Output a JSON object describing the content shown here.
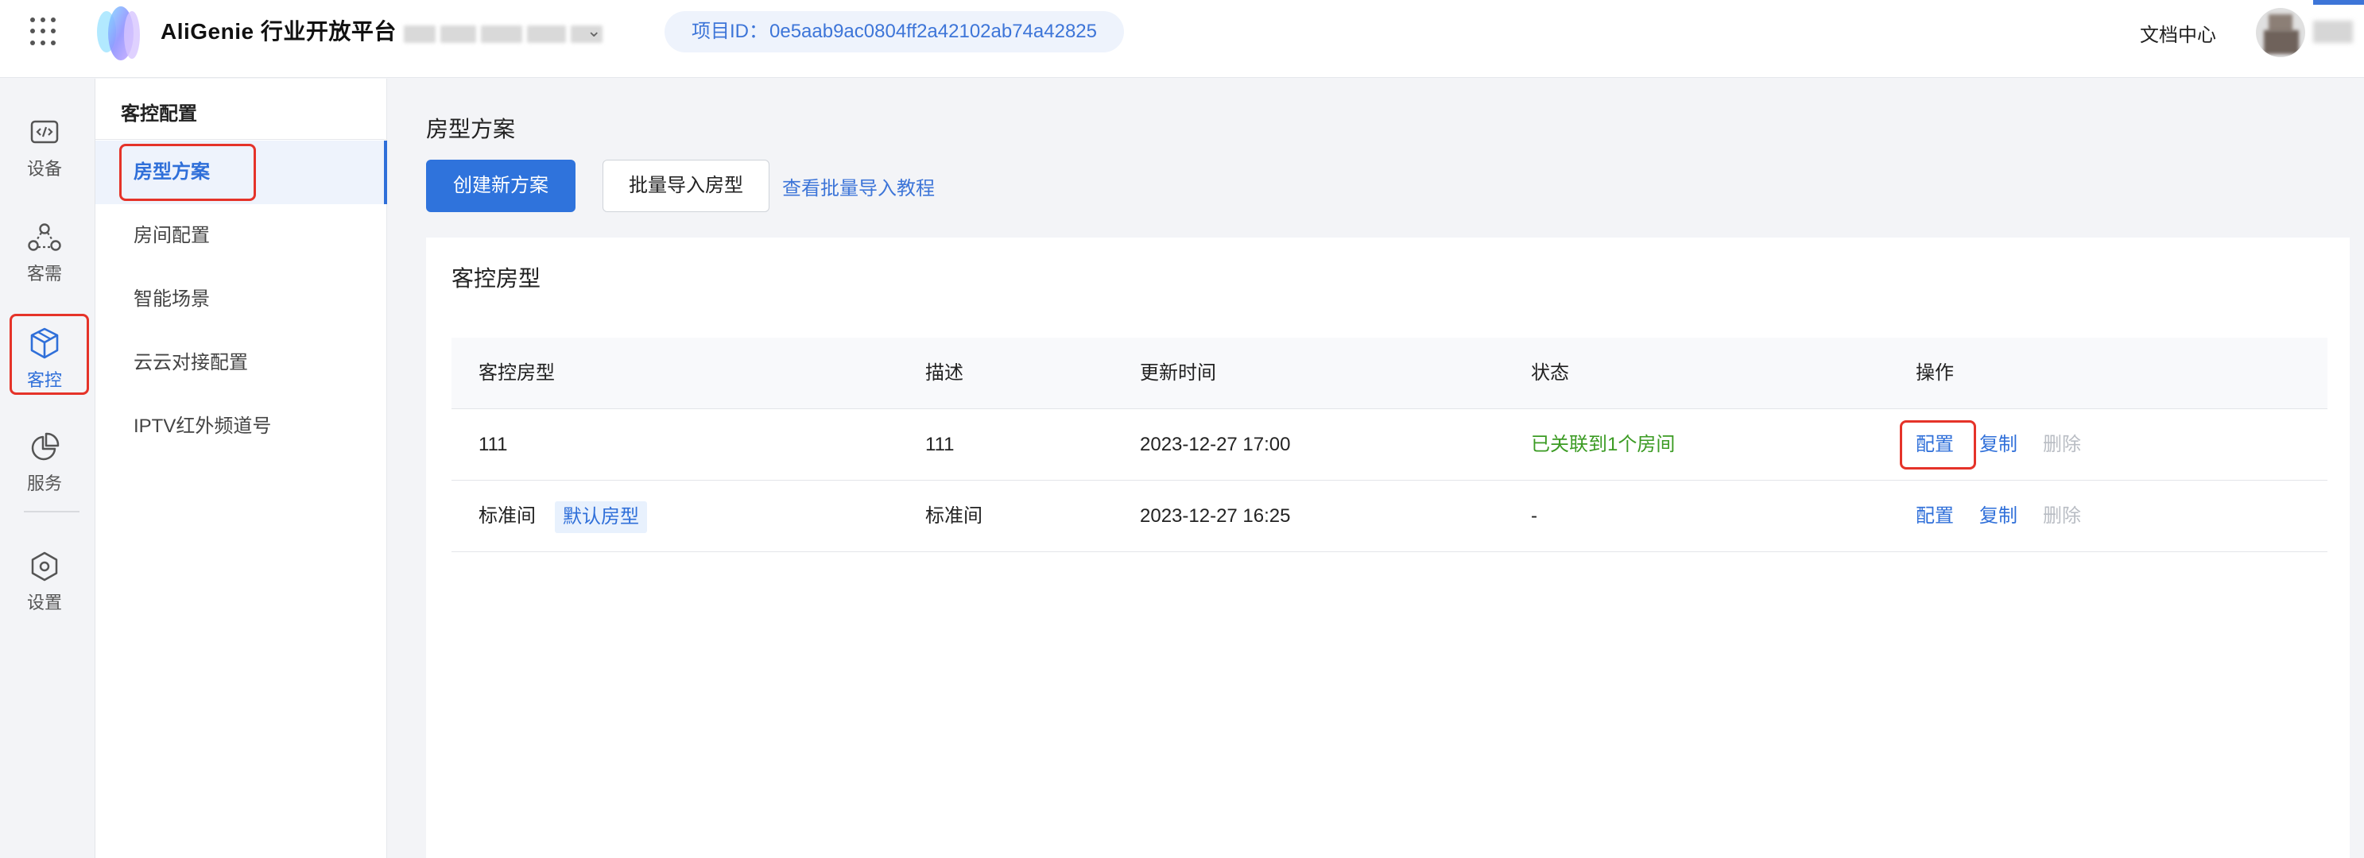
{
  "header": {
    "brand": "AliGenie 行业开放平台",
    "project_id_label": "项目ID：",
    "project_id": "0e5aab9ac0804ff2a42102ab74a42825",
    "doc_center": "文档中心"
  },
  "rail": {
    "items": [
      {
        "label": "设备",
        "icon": "device-icon"
      },
      {
        "label": "客需",
        "icon": "customer-demand-icon"
      },
      {
        "label": "客控",
        "icon": "room-control-icon",
        "active": true
      },
      {
        "label": "服务",
        "icon": "service-pie-icon"
      },
      {
        "label": "设置",
        "icon": "settings-hex-icon"
      }
    ]
  },
  "menu": {
    "title": "客控配置",
    "items": [
      {
        "label": "房型方案",
        "active": true
      },
      {
        "label": "房间配置"
      },
      {
        "label": "智能场景"
      },
      {
        "label": "云云对接配置"
      },
      {
        "label": "IPTV红外频道号"
      }
    ]
  },
  "main": {
    "title": "房型方案",
    "create_button": "创建新方案",
    "import_button": "批量导入房型",
    "tutorial_link": "查看批量导入教程",
    "card_title": "客控房型",
    "table": {
      "columns": [
        "客控房型",
        "描述",
        "更新时间",
        "状态",
        "操作"
      ],
      "rows": [
        {
          "name": "111",
          "tag": "",
          "desc": "111",
          "updated": "2023-12-27 17:00",
          "status": "已关联到1个房间"
        },
        {
          "name": "标准间",
          "tag": "默认房型",
          "desc": "标准间",
          "updated": "2023-12-27 16:25",
          "status": "-"
        }
      ],
      "actions": {
        "configure": "配置",
        "copy": "复制",
        "delete": "删除"
      }
    }
  },
  "colors": {
    "primary": "#2f73dc",
    "link": "#3d75d8",
    "success": "#3b9b23",
    "highlight_box": "#e53329",
    "disabled": "#b9bdc4"
  }
}
